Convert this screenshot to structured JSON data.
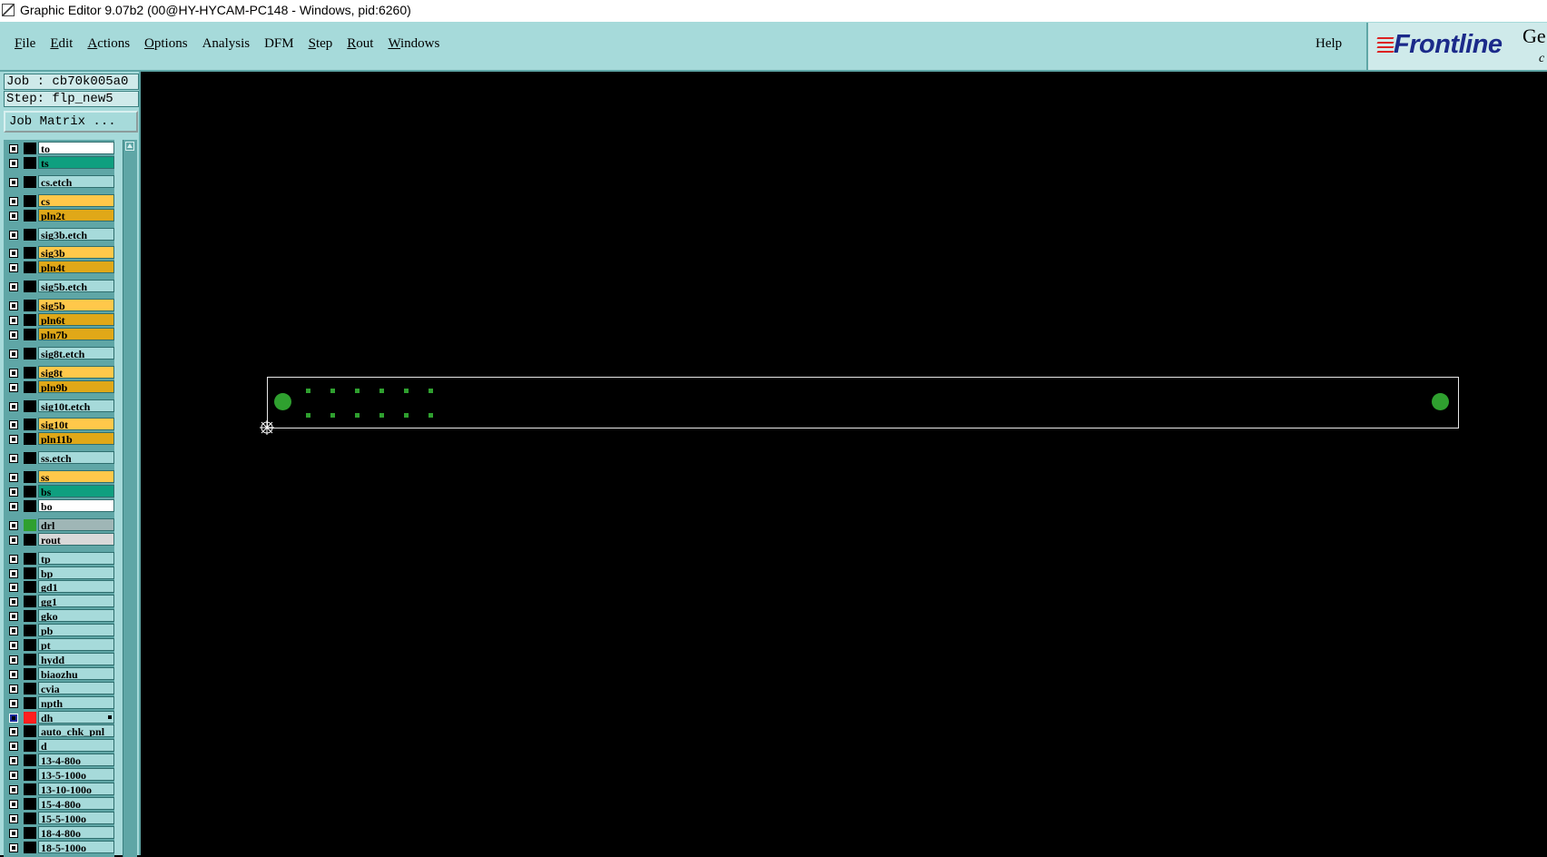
{
  "window": {
    "title": "Graphic Editor 9.07b2 (00@HY-HYCAM-PC148 - Windows, pid:6260)"
  },
  "menubar": {
    "items": [
      {
        "mn": "F",
        "rest": "ile"
      },
      {
        "mn": "E",
        "rest": "dit"
      },
      {
        "mn": "A",
        "rest": "ctions"
      },
      {
        "mn": "O",
        "rest": "ptions"
      },
      {
        "mn": "",
        "rest": "Analysis"
      },
      {
        "mn": "",
        "rest": "DFM"
      },
      {
        "mn": "S",
        "rest": "tep"
      },
      {
        "mn": "R",
        "rest": "out"
      },
      {
        "mn": "W",
        "rest": "indows"
      }
    ],
    "help": "Help",
    "logo": {
      "text": "Frontline",
      "extra": "Ge",
      "extra2": "c",
      "lines_color": "#dd2222",
      "text_color": "#1b2a8a"
    }
  },
  "leftpanel": {
    "job": "Job : cb70k005a0",
    "step": "Step: flp_new5",
    "job_matrix_button": "Job Matrix ...",
    "layers": [
      {
        "name": "to",
        "color": "#ffffff",
        "row": 0,
        "gap": 0
      },
      {
        "name": "ts",
        "color": "#0f9f7f",
        "row": 1,
        "gap": 0
      },
      {
        "name": "cs.etch",
        "color": "#a6dada",
        "row": 2,
        "gap": 1
      },
      {
        "name": "cs",
        "color": "#ffc84a",
        "row": 3,
        "gap": 2
      },
      {
        "name": "pln2t",
        "color": "#e0a818",
        "row": 4,
        "gap": 2
      },
      {
        "name": "sig3b.etch",
        "color": "#a6dada",
        "row": 5,
        "gap": 3
      },
      {
        "name": "sig3b",
        "color": "#ffc84a",
        "row": 6,
        "gap": 4
      },
      {
        "name": "pln4t",
        "color": "#e0a818",
        "row": 7,
        "gap": 4
      },
      {
        "name": "sig5b.etch",
        "color": "#a6dada",
        "row": 8,
        "gap": 5
      },
      {
        "name": "sig5b",
        "color": "#ffc84a",
        "row": 9,
        "gap": 6
      },
      {
        "name": "pln6t",
        "color": "#e0a818",
        "row": 10,
        "gap": 6
      },
      {
        "name": "pln7b",
        "color": "#e0a818",
        "row": 11,
        "gap": 6
      },
      {
        "name": "sig8t.etch",
        "color": "#a6dada",
        "row": 12,
        "gap": 7
      },
      {
        "name": "sig8t",
        "color": "#ffc84a",
        "row": 13,
        "gap": 8
      },
      {
        "name": "pln9b",
        "color": "#e0a818",
        "row": 14,
        "gap": 8
      },
      {
        "name": "sig10t.etch",
        "color": "#a6dada",
        "row": 15,
        "gap": 9
      },
      {
        "name": "sig10t",
        "color": "#ffc84a",
        "row": 16,
        "gap": 10
      },
      {
        "name": "pln11b",
        "color": "#e0a818",
        "row": 17,
        "gap": 10
      },
      {
        "name": "ss.etch",
        "color": "#a6dada",
        "row": 18,
        "gap": 11
      },
      {
        "name": "ss",
        "color": "#ffc84a",
        "row": 19,
        "gap": 12
      },
      {
        "name": "bs",
        "color": "#0f9f7f",
        "row": 20,
        "gap": 12
      },
      {
        "name": "bo",
        "color": "#ffffff",
        "row": 21,
        "gap": 12
      },
      {
        "name": "drl",
        "color": "#9fb6b6",
        "row": 22,
        "gap": 13,
        "sw": "#2fa02f"
      },
      {
        "name": "rout",
        "color": "#d9d9d9",
        "row": 23,
        "gap": 13
      },
      {
        "name": "tp",
        "color": "#a6dada",
        "row": 24,
        "gap": 14
      },
      {
        "name": "bp",
        "color": "#a6dada",
        "row": 25,
        "gap": 14
      },
      {
        "name": "gd1",
        "color": "#a6dada",
        "row": 26,
        "gap": 14
      },
      {
        "name": "gg1",
        "color": "#a6dada",
        "row": 27,
        "gap": 14
      },
      {
        "name": "gko",
        "color": "#a6dada",
        "row": 28,
        "gap": 14
      },
      {
        "name": "pb",
        "color": "#a6dada",
        "row": 29,
        "gap": 14
      },
      {
        "name": "pt",
        "color": "#a6dada",
        "row": 30,
        "gap": 14
      },
      {
        "name": "hydd",
        "color": "#a6dada",
        "row": 31,
        "gap": 14
      },
      {
        "name": "biaozhu",
        "color": "#a6dada",
        "row": 32,
        "gap": 14
      },
      {
        "name": "cvia",
        "color": "#a6dada",
        "row": 33,
        "gap": 14
      },
      {
        "name": "npth",
        "color": "#a6dada",
        "row": 34,
        "gap": 14
      },
      {
        "name": "dh",
        "color": "#a6dada",
        "row": 35,
        "gap": 14,
        "sw": "#ff1e1e",
        "active": true,
        "mark": true
      },
      {
        "name": "auto_chk_pnl",
        "color": "#a6dada",
        "row": 36,
        "gap": 14
      },
      {
        "name": "d",
        "color": "#a6dada",
        "row": 37,
        "gap": 14
      },
      {
        "name": "13-4-80o",
        "color": "#a6dada",
        "row": 38,
        "gap": 14
      },
      {
        "name": "13-5-100o",
        "color": "#a6dada",
        "row": 39,
        "gap": 14
      },
      {
        "name": "13-10-100o",
        "color": "#a6dada",
        "row": 40,
        "gap": 14
      },
      {
        "name": "15-4-80o",
        "color": "#a6dada",
        "row": 41,
        "gap": 14
      },
      {
        "name": "15-5-100o",
        "color": "#a6dada",
        "row": 42,
        "gap": 14
      },
      {
        "name": "18-4-80o",
        "color": "#a6dada",
        "row": 43,
        "gap": 14
      },
      {
        "name": "18-5-100o",
        "color": "#a6dada",
        "row": 44,
        "gap": 14
      }
    ]
  },
  "canvas": {
    "pad_color": "#2fa02f",
    "outline_color": "#e8e8e8"
  }
}
